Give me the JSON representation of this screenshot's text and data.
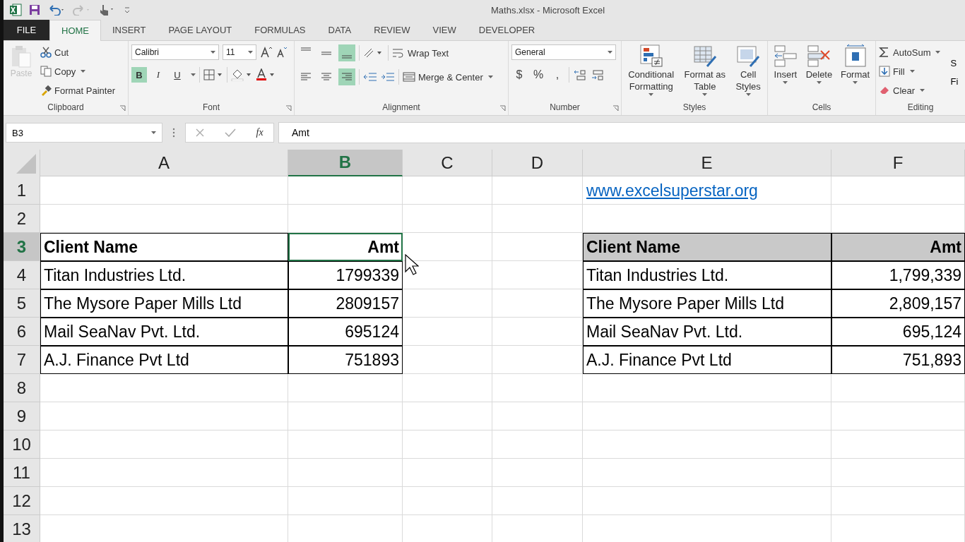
{
  "window": {
    "title": "Maths.xlsx - Microsoft Excel"
  },
  "tabs": [
    {
      "label": "FILE",
      "kind": "file",
      "selected": false
    },
    {
      "label": "HOME",
      "kind": "tab",
      "selected": true
    },
    {
      "label": "INSERT",
      "kind": "tab",
      "selected": false
    },
    {
      "label": "PAGE LAYOUT",
      "kind": "tab",
      "selected": false
    },
    {
      "label": "FORMULAS",
      "kind": "tab",
      "selected": false
    },
    {
      "label": "DATA",
      "kind": "tab",
      "selected": false
    },
    {
      "label": "REVIEW",
      "kind": "tab",
      "selected": false
    },
    {
      "label": "VIEW",
      "kind": "tab",
      "selected": false
    },
    {
      "label": "DEVELOPER",
      "kind": "tab",
      "selected": false
    }
  ],
  "ribbon": {
    "clipboard": {
      "label": "Clipboard",
      "paste": {
        "label": "Paste",
        "disabled": true
      },
      "items": [
        {
          "label": "Cut",
          "kind": "cut"
        },
        {
          "label": "Copy",
          "kind": "copy"
        },
        {
          "label": "Format Painter",
          "kind": "painter"
        }
      ]
    },
    "font": {
      "label": "Font",
      "name": "Calibri",
      "size": "11",
      "styles": [
        {
          "label": "B",
          "kind": "bold",
          "selected": true
        },
        {
          "label": "I",
          "kind": "italic",
          "selected": false
        },
        {
          "label": "U",
          "kind": "underline",
          "selected": false
        }
      ]
    },
    "alignment": {
      "label": "Alignment",
      "vertical": [
        {
          "kind": "top",
          "selected": false
        },
        {
          "kind": "middle",
          "selected": false
        },
        {
          "kind": "bottom",
          "selected": true
        }
      ],
      "horizontal": [
        {
          "kind": "left",
          "selected": false
        },
        {
          "kind": "center",
          "selected": false
        },
        {
          "kind": "right",
          "selected": true
        }
      ],
      "wrap_text": "Wrap Text",
      "merge": "Merge & Center"
    },
    "number": {
      "label": "Number",
      "format": "General",
      "symbols": [
        "$",
        "%",
        ","
      ]
    },
    "styles": {
      "label": "Styles",
      "buttons": [
        {
          "lines": [
            "Conditional",
            "Formatting"
          ],
          "kind": "conditional"
        },
        {
          "lines": [
            "Format as",
            "Table"
          ],
          "kind": "table"
        },
        {
          "lines": [
            "Cell",
            "Styles"
          ],
          "kind": "cellstyles"
        }
      ]
    },
    "cells": {
      "label": "Cells",
      "buttons": [
        {
          "label": "Insert",
          "kind": "insert"
        },
        {
          "label": "Delete",
          "kind": "delete"
        },
        {
          "label": "Format",
          "kind": "format"
        }
      ]
    },
    "editing": {
      "label": "Editing",
      "items": [
        {
          "label": "AutoSum",
          "kind": "autosum"
        },
        {
          "label": "Fill",
          "kind": "fill"
        },
        {
          "label": "Clear",
          "kind": "clear"
        }
      ],
      "cut_lines": [
        "S",
        "Fi"
      ]
    }
  },
  "formula_bar": {
    "name_box": "B3",
    "fx": "fx",
    "formula": "Amt"
  },
  "sheet": {
    "columns": [
      {
        "label": "A",
        "selected": false
      },
      {
        "label": "B",
        "selected": true
      },
      {
        "label": "C",
        "selected": false
      },
      {
        "label": "D",
        "selected": false
      },
      {
        "label": "E",
        "selected": false
      },
      {
        "label": "F",
        "selected": false
      }
    ],
    "rows": [
      {
        "label": "1",
        "selected": false,
        "cells": [
          "",
          "",
          "",
          "",
          {
            "text": "www.excelsuperstar.org",
            "kind": "link"
          },
          ""
        ]
      },
      {
        "label": "2",
        "selected": false
      },
      {
        "label": "3",
        "selected": true,
        "cells": [
          {
            "text": "Client Name",
            "kind": "header",
            "bordered": true,
            "filled": false,
            "selected": false
          },
          {
            "text": "Amt",
            "kind": "header_number",
            "bordered": true,
            "filled": false,
            "selected": true
          },
          "",
          "",
          {
            "text": "Client Name",
            "kind": "header",
            "bordered": true,
            "filled": true,
            "selected": false
          },
          {
            "text": "Amt",
            "kind": "header_number",
            "bordered": true,
            "filled": true,
            "selected": false
          }
        ]
      },
      {
        "label": "4",
        "selected": false,
        "cells": [
          {
            "text": "Titan Industries Ltd.",
            "kind": "text",
            "bordered": true
          },
          {
            "text": "1799339",
            "kind": "number",
            "bordered": true
          },
          "",
          "",
          {
            "text": "Titan Industries Ltd.",
            "kind": "text",
            "bordered": true
          },
          {
            "text": "1,799,339",
            "kind": "number",
            "bordered": true
          }
        ]
      },
      {
        "label": "5",
        "selected": false,
        "cells": [
          {
            "text": "The Mysore Paper Mills Ltd",
            "kind": "text",
            "bordered": true
          },
          {
            "text": "2809157",
            "kind": "number",
            "bordered": true
          },
          "",
          "",
          {
            "text": "The Mysore Paper Mills Ltd",
            "kind": "text",
            "bordered": true
          },
          {
            "text": "2,809,157",
            "kind": "number",
            "bordered": true
          }
        ]
      },
      {
        "label": "6",
        "selected": false,
        "cells": [
          {
            "text": "Mail SeaNav Pvt. Ltd.",
            "kind": "text",
            "bordered": true
          },
          {
            "text": "695124",
            "kind": "number",
            "bordered": true
          },
          "",
          "",
          {
            "text": "Mail SeaNav Pvt. Ltd.",
            "kind": "text",
            "bordered": true
          },
          {
            "text": "695,124",
            "kind": "number",
            "bordered": true
          }
        ]
      },
      {
        "label": "7",
        "selected": false,
        "cells": [
          {
            "text": "A.J. Finance Pvt Ltd",
            "kind": "text",
            "bordered": true
          },
          {
            "text": "751893",
            "kind": "number",
            "bordered": true
          },
          "",
          "",
          {
            "text": "A.J. Finance Pvt Ltd",
            "kind": "text",
            "bordered": true
          },
          {
            "text": "751,893",
            "kind": "number",
            "bordered": true
          }
        ]
      },
      {
        "label": "8",
        "selected": false
      },
      {
        "label": "9",
        "selected": false
      },
      {
        "label": "10",
        "selected": false
      },
      {
        "label": "11",
        "selected": false
      },
      {
        "label": "12",
        "selected": false
      },
      {
        "label": "13",
        "selected": false
      }
    ]
  }
}
